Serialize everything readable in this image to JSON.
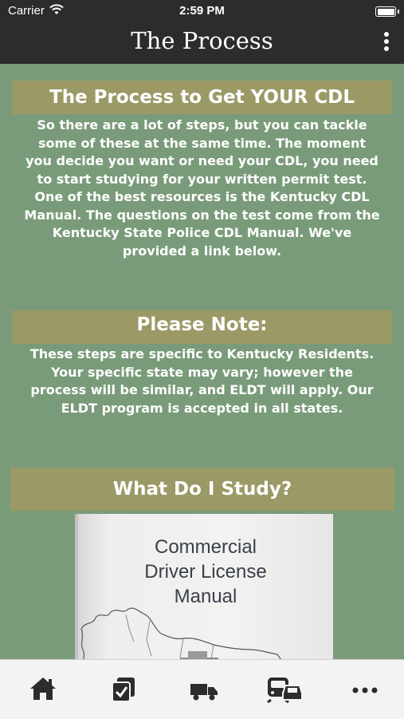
{
  "status_bar": {
    "carrier": "Carrier",
    "time": "2:59 PM"
  },
  "nav": {
    "title": "The Process",
    "more_icon": "more-vertical-icon"
  },
  "sections": [
    {
      "heading": "The Process to Get YOUR CDL",
      "lines": [
        "So there are a lot of steps, but you can tackle",
        "some of these at the same time. The moment",
        "you decide you want or need your CDL, you need",
        "to start studying for your written permit test.",
        "One of the best resources is the Kentucky CDL",
        "Manual. The questions on the test come from the",
        "Kentucky State Police CDL Manual. We've",
        "provided a link below."
      ]
    },
    {
      "heading": "Please Note:",
      "lines": [
        "These steps are specific to Kentucky Residents.",
        "Your specific state may vary; however the",
        "process will be similar, and ELDT will apply. Our",
        "ELDT program is accepted in all states."
      ]
    },
    {
      "heading": "What Do I Study?"
    }
  ],
  "book": {
    "lines": [
      "Commercial",
      "Driver License",
      "Manual"
    ]
  },
  "tab_bar": [
    {
      "icon": "home-icon"
    },
    {
      "icon": "checklist-icon"
    },
    {
      "icon": "truck-icon"
    },
    {
      "icon": "bus-car-icon"
    },
    {
      "icon": "more-horizontal-icon"
    }
  ],
  "colors": {
    "background": "#7a9b7a",
    "banner": "#9b9966",
    "bar": "#2c2d2b"
  }
}
